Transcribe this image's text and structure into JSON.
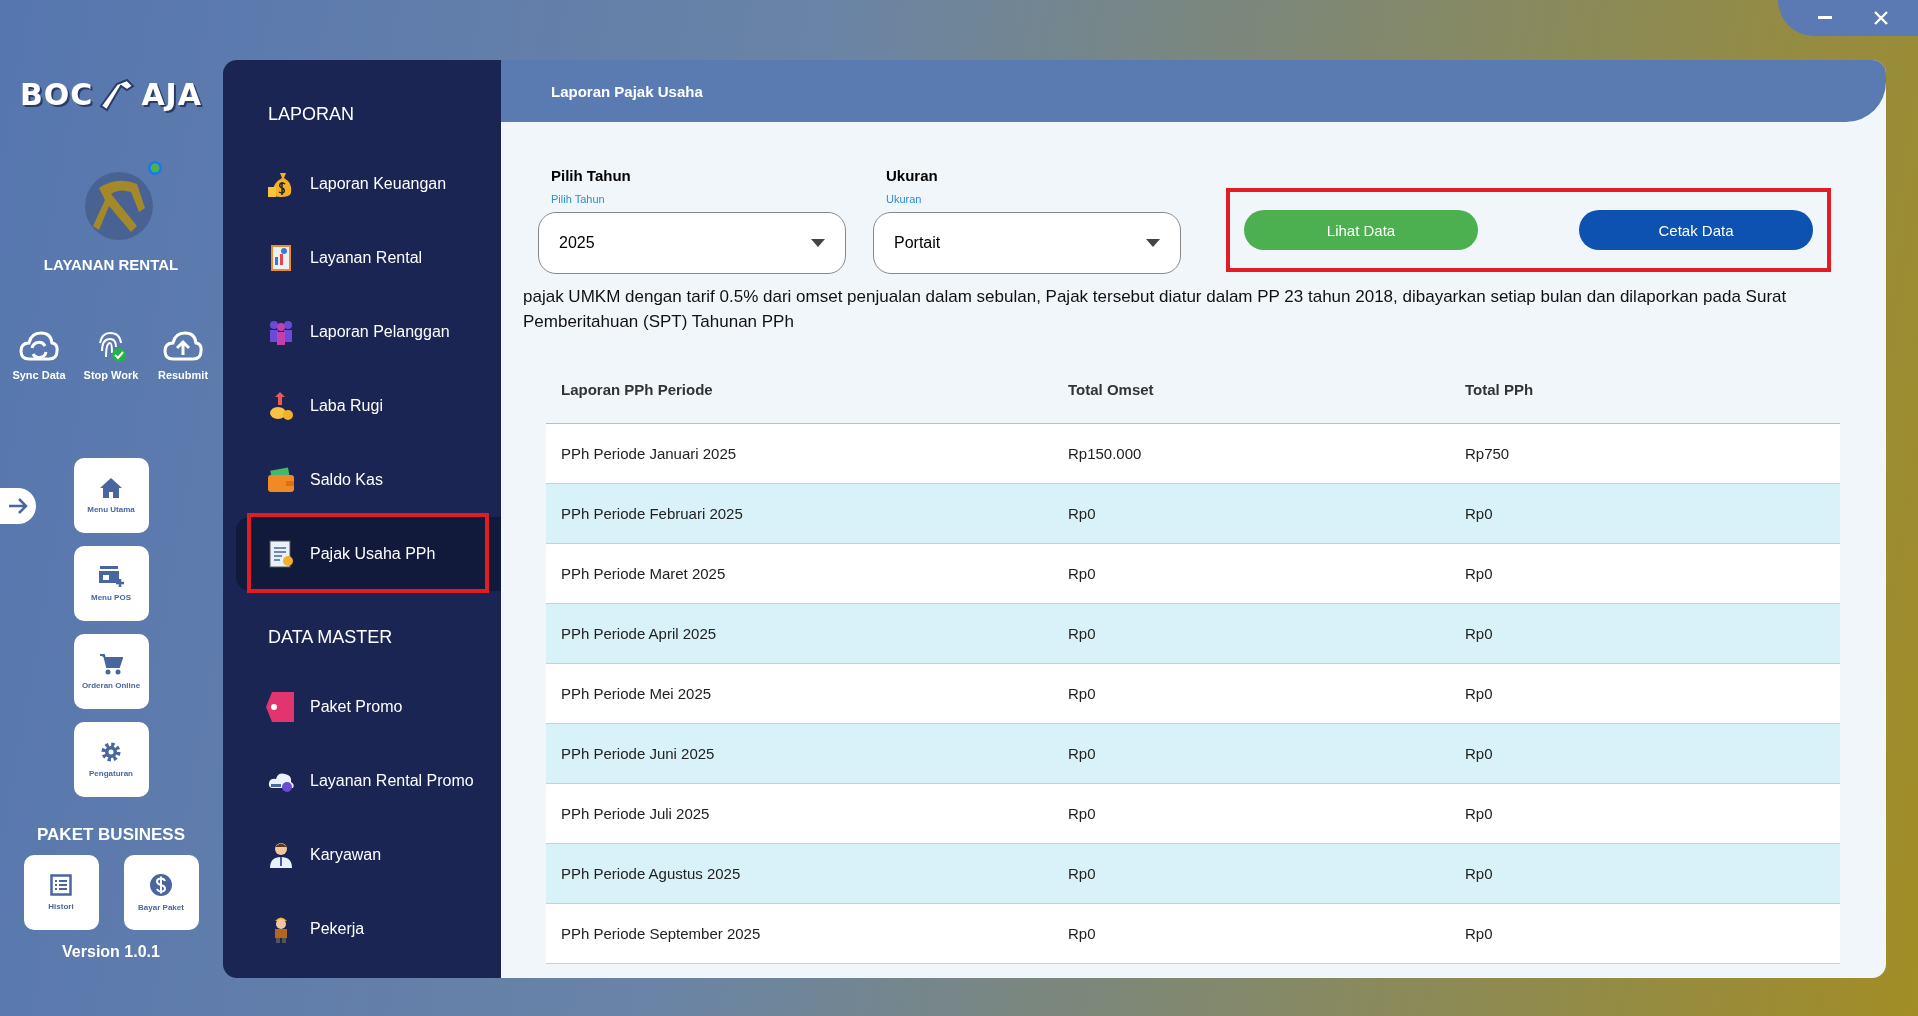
{
  "sidebar": {
    "logo": {
      "left": "BOC",
      "right": "AJA"
    },
    "app_title": "LAYANAN RENTAL",
    "actions": [
      {
        "label": "Sync Data"
      },
      {
        "label": "Stop Work"
      },
      {
        "label": "Resubmit"
      }
    ],
    "menu": [
      {
        "label": "Menu Utama"
      },
      {
        "label": "Menu POS"
      },
      {
        "label": "Orderan Online"
      },
      {
        "label": "Pengaturan"
      }
    ],
    "package_title": "PAKET BUSINESS",
    "package_buttons": [
      {
        "label": "Histori"
      },
      {
        "label": "Bayar Paket"
      }
    ],
    "version": "Version 1.0.1"
  },
  "nav": {
    "sections": [
      {
        "title": "LAPORAN",
        "items": [
          {
            "label": "Laporan Keuangan",
            "selected": false,
            "highlighted": false
          },
          {
            "label": "Layanan Rental",
            "selected": false,
            "highlighted": false
          },
          {
            "label": "Laporan Pelanggan",
            "selected": false,
            "highlighted": false
          },
          {
            "label": "Laba Rugi",
            "selected": false,
            "highlighted": false
          },
          {
            "label": "Saldo Kas",
            "selected": false,
            "highlighted": false
          },
          {
            "label": "Pajak Usaha PPh",
            "selected": true,
            "highlighted": true
          }
        ]
      },
      {
        "title": "DATA MASTER",
        "items": [
          {
            "label": "Paket Promo",
            "selected": false,
            "highlighted": false
          },
          {
            "label": "Layanan Rental Promo",
            "selected": false,
            "highlighted": false
          },
          {
            "label": "Karyawan",
            "selected": false,
            "highlighted": false
          },
          {
            "label": "Pekerja",
            "selected": false,
            "highlighted": false
          }
        ]
      }
    ]
  },
  "main": {
    "title": "Laporan Pajak Usaha",
    "selects": [
      {
        "label": "Pilih Tahun",
        "floating_label": "Pilih Tahun",
        "value": "2025"
      },
      {
        "label": "Ukuran",
        "floating_label": "Ukuran",
        "value": "Portait"
      }
    ],
    "buttons_highlighted": true,
    "buttons": [
      {
        "label": "Lihat Data",
        "kind": "secondary"
      },
      {
        "label": "Cetak Data",
        "kind": "primary"
      }
    ],
    "description": "pajak UMKM dengan tarif 0.5% dari omset penjualan dalam sebulan, Pajak tersebut diatur dalam PP 23 tahun 2018, dibayarkan setiap bulan dan dilaporkan pada Surat Pemberitahuan (SPT) Tahunan PPh",
    "table": {
      "columns": [
        "Laporan PPh Periode",
        "Total Omset",
        "Total PPh"
      ],
      "rows": [
        [
          "PPh Periode Januari 2025",
          "Rp150.000",
          "Rp750"
        ],
        [
          "PPh Periode Februari 2025",
          "Rp0",
          "Rp0"
        ],
        [
          "PPh Periode Maret 2025",
          "Rp0",
          "Rp0"
        ],
        [
          "PPh Periode April 2025",
          "Rp0",
          "Rp0"
        ],
        [
          "PPh Periode Mei 2025",
          "Rp0",
          "Rp0"
        ],
        [
          "PPh Periode Juni 2025",
          "Rp0",
          "Rp0"
        ],
        [
          "PPh Periode Juli 2025",
          "Rp0",
          "Rp0"
        ],
        [
          "PPh Periode Agustus 2025",
          "Rp0",
          "Rp0"
        ],
        [
          "PPh Periode September 2025",
          "Rp0",
          "Rp0"
        ]
      ]
    }
  }
}
